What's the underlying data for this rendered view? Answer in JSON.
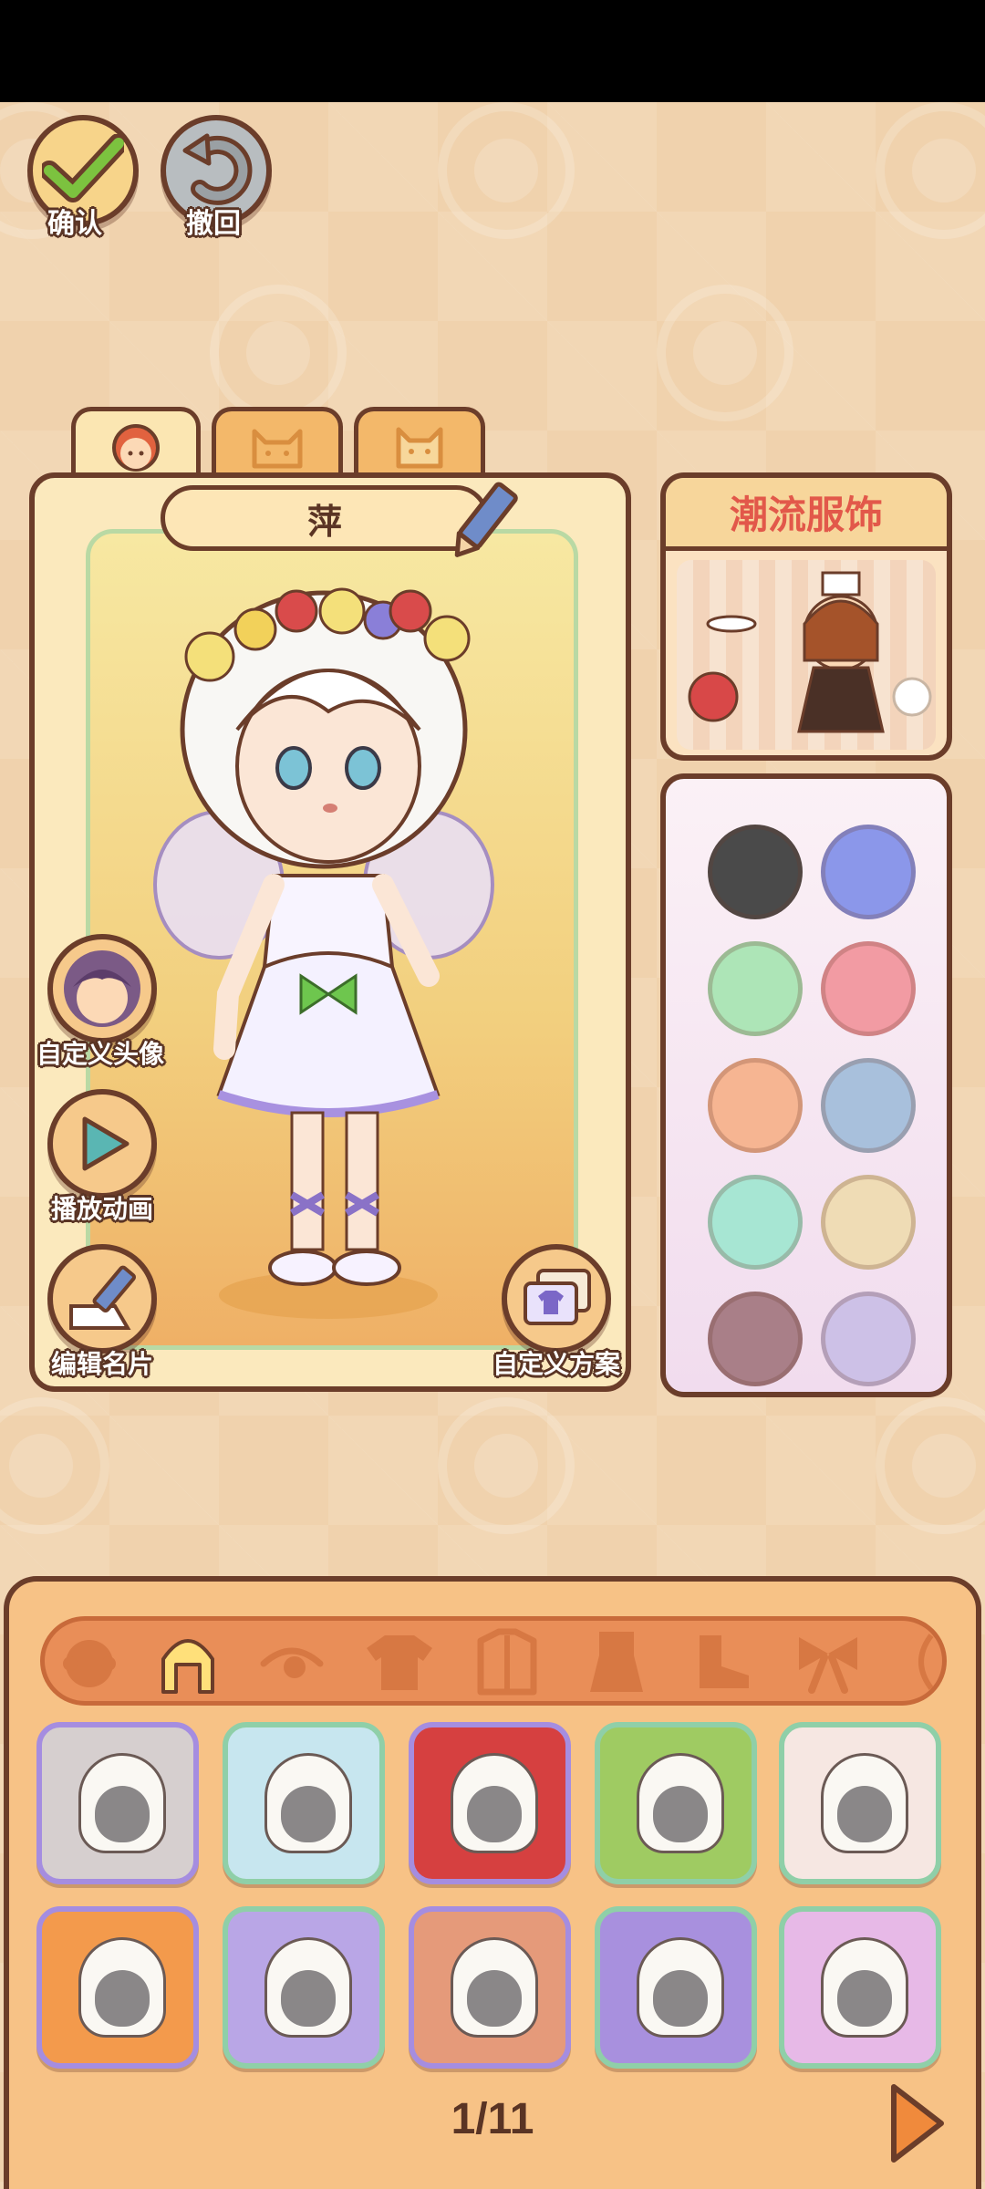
{
  "top_buttons": {
    "confirm_label": "确认",
    "undo_label": "撤回"
  },
  "tabs": [
    {
      "icon": "character-face-icon",
      "active": true
    },
    {
      "icon": "cat-face-icon",
      "active": false
    },
    {
      "icon": "cat-face-icon",
      "active": false
    }
  ],
  "character": {
    "name": "萍"
  },
  "side_buttons": {
    "custom_avatar_label": "自定义头像",
    "play_animation_label": "播放动画",
    "edit_card_label": "编辑名片",
    "custom_outfit_label": "自定义方案"
  },
  "fashion_card": {
    "title": "潮流服饰"
  },
  "colors": {
    "swatches": [
      "#4a4a4a",
      "#8b97ea",
      "#ade5b7",
      "#f29ba3",
      "#f6b592",
      "#a8c0dc",
      "#a7e6d3",
      "#efdcb5",
      "#a97f88",
      "#cdc1e7"
    ]
  },
  "categories": [
    {
      "icon": "face-category-icon",
      "active": false
    },
    {
      "icon": "hair-category-icon",
      "active": true
    },
    {
      "icon": "eye-category-icon",
      "active": false
    },
    {
      "icon": "top-category-icon",
      "active": false
    },
    {
      "icon": "coat-category-icon",
      "active": false
    },
    {
      "icon": "dress-category-icon",
      "active": false
    },
    {
      "icon": "shoe-category-icon",
      "active": false
    },
    {
      "icon": "bow-category-icon",
      "active": false
    },
    {
      "icon": "more-category-icon",
      "active": false
    }
  ],
  "hair_items": [
    {
      "bg": "#d6cfcf",
      "border": "#a58de0"
    },
    {
      "bg": "#c7e6ef",
      "border": "#8fcfa8"
    },
    {
      "bg": "#d64040",
      "border": "#a58de0"
    },
    {
      "bg": "#9fcb62",
      "border": "#8fcfa8"
    },
    {
      "bg": "#f6e7e2",
      "border": "#8fcfa8"
    },
    {
      "bg": "#f39a4c",
      "border": "#a58de0"
    },
    {
      "bg": "#b9a6e6",
      "border": "#8fcfa8"
    },
    {
      "bg": "#e59a7a",
      "border": "#a58de0"
    },
    {
      "bg": "#a890de",
      "border": "#8fcfa8"
    },
    {
      "bg": "#e7b9e7",
      "border": "#8fcfa8"
    }
  ],
  "pager": {
    "text": "1/11"
  },
  "palette": {
    "outline": "#6b3d2a",
    "confirm_green": "#7cc23f",
    "undo_gray": "#9aa0a4",
    "accent_red": "#e2584a"
  }
}
